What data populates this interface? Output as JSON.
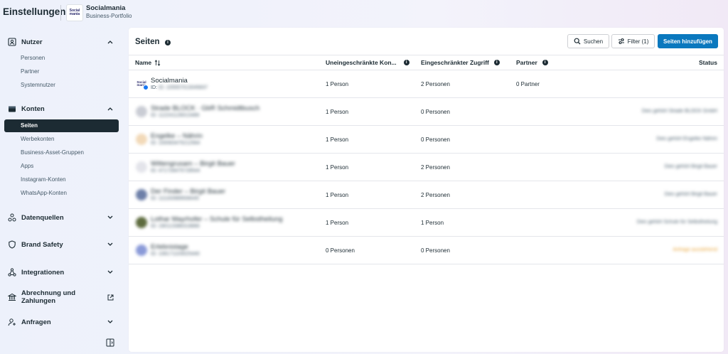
{
  "app_title": "Einstellungen",
  "business": {
    "logo_text": "Social mania",
    "name": "Socialmania",
    "subtitle": "Business-Portfolio"
  },
  "sidebar": {
    "nutzer": {
      "label": "Nutzer",
      "items": [
        "Personen",
        "Partner",
        "Systemnutzer"
      ]
    },
    "konten": {
      "label": "Konten",
      "items": [
        "Seiten",
        "Werbekonten",
        "Business-Asset-Gruppen",
        "Apps",
        "Instagram-Konten",
        "WhatsApp-Konten"
      ]
    },
    "datenquellen": "Datenquellen",
    "brand_safety": "Brand Safety",
    "integrationen": "Integrationen",
    "abrechnung": "Abrechnung und Zahlungen",
    "anfragen": "Anfragen"
  },
  "main": {
    "title": "Seiten",
    "search_label": "Suchen",
    "filter_label": "Filter (1)",
    "add_label": "Seiten hinzufügen",
    "columns": {
      "name": "Name",
      "unrestricted": "Uneingeschränkte Kon...",
      "restricted": "Eingeschränkter Zugriff",
      "partner": "Partner",
      "status": "Status"
    },
    "rows": [
      {
        "name": "Socialmania",
        "id": "ID: 105557013045837",
        "unrestricted": "1 Person",
        "restricted": "2 Personen",
        "partner": "0 Partner",
        "status": ""
      },
      {
        "name": "Strade BLOCK · GbR Schmidtbusch",
        "id": "ID: 112241126013489",
        "unrestricted": "1 Person",
        "restricted": "0 Personen",
        "partner": "",
        "status": "Dies gehört Strade BLOCK GmbH"
      },
      {
        "name": "Engelke – Nährin",
        "id": "ID: 100063475212564",
        "unrestricted": "1 Person",
        "restricted": "0 Personen",
        "partner": "",
        "status": "Dies gehört Engelke Nährin"
      },
      {
        "name": "Wittengrusam – Birgit Bauer",
        "id": "ID: 471728475728544",
        "unrestricted": "1 Person",
        "restricted": "2 Personen",
        "partner": "",
        "status": "Dies gehört Birgit Bauer"
      },
      {
        "name": "Der Finder – Birgit Bauer",
        "id": "ID: 111163989508445",
        "unrestricted": "1 Person",
        "restricted": "2 Personen",
        "partner": "",
        "status": "Dies gehört Birgit Bauer"
      },
      {
        "name": "Lothar Mayrhofer – Schule für Selbstheilung",
        "id": "ID: 190113386318866",
        "unrestricted": "1 Person",
        "restricted": "1 Person",
        "partner": "",
        "status": "Dies gehört Schule für Selbstheilung"
      },
      {
        "name": "Erlebnistage",
        "id": "ID: 108171103025440",
        "unrestricted": "0 Personen",
        "restricted": "0 Personen",
        "partner": "",
        "status": "Anfrage ausstehend"
      }
    ]
  },
  "colors": {
    "accent": "#0a78be",
    "active_bg": "#1c2b33",
    "pending": "#e8a030"
  }
}
